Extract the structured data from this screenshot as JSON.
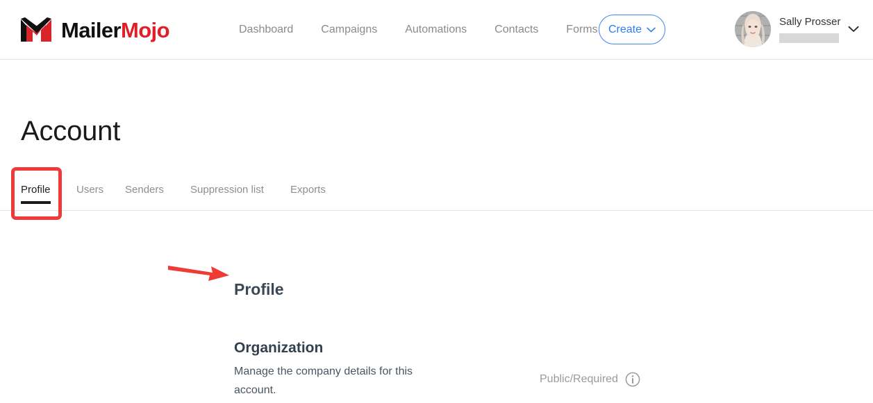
{
  "header": {
    "brand": {
      "mark_icon": "mailer-envelope-m-icon",
      "name_first": "Mailer",
      "name_second": "Mojo",
      "color_primary": "#111111",
      "color_accent": "#e01f26"
    },
    "nav": [
      {
        "label": "Dashboard"
      },
      {
        "label": "Campaigns"
      },
      {
        "label": "Automations"
      },
      {
        "label": "Contacts"
      },
      {
        "label": "Forms"
      }
    ],
    "create_button": {
      "label": "Create",
      "chevron_icon": "chevron-down-icon",
      "color": "#2b7cf6"
    },
    "user": {
      "name": "Sally Prosser",
      "avatar_icon": "user-avatar-photo",
      "redacted_value": "",
      "chevron_icon": "chevron-down-icon"
    }
  },
  "page": {
    "title": "Account"
  },
  "tabs": [
    {
      "label": "Profile",
      "active": true
    },
    {
      "label": "Users",
      "active": false
    },
    {
      "label": "Senders",
      "active": false
    },
    {
      "label": "Suppression list",
      "active": false
    },
    {
      "label": "Exports",
      "active": false
    }
  ],
  "annotations": {
    "box_color": "#f03a3a",
    "arrow_color": "#ee3b33",
    "box_target": "Profile",
    "arrow_target": "Profile"
  },
  "content": {
    "section_heading": "Profile",
    "organization": {
      "title": "Organization",
      "description": "Manage the company details for this account."
    },
    "visibility": {
      "label": "Public/Required",
      "info_icon": "info-circle-icon"
    }
  }
}
